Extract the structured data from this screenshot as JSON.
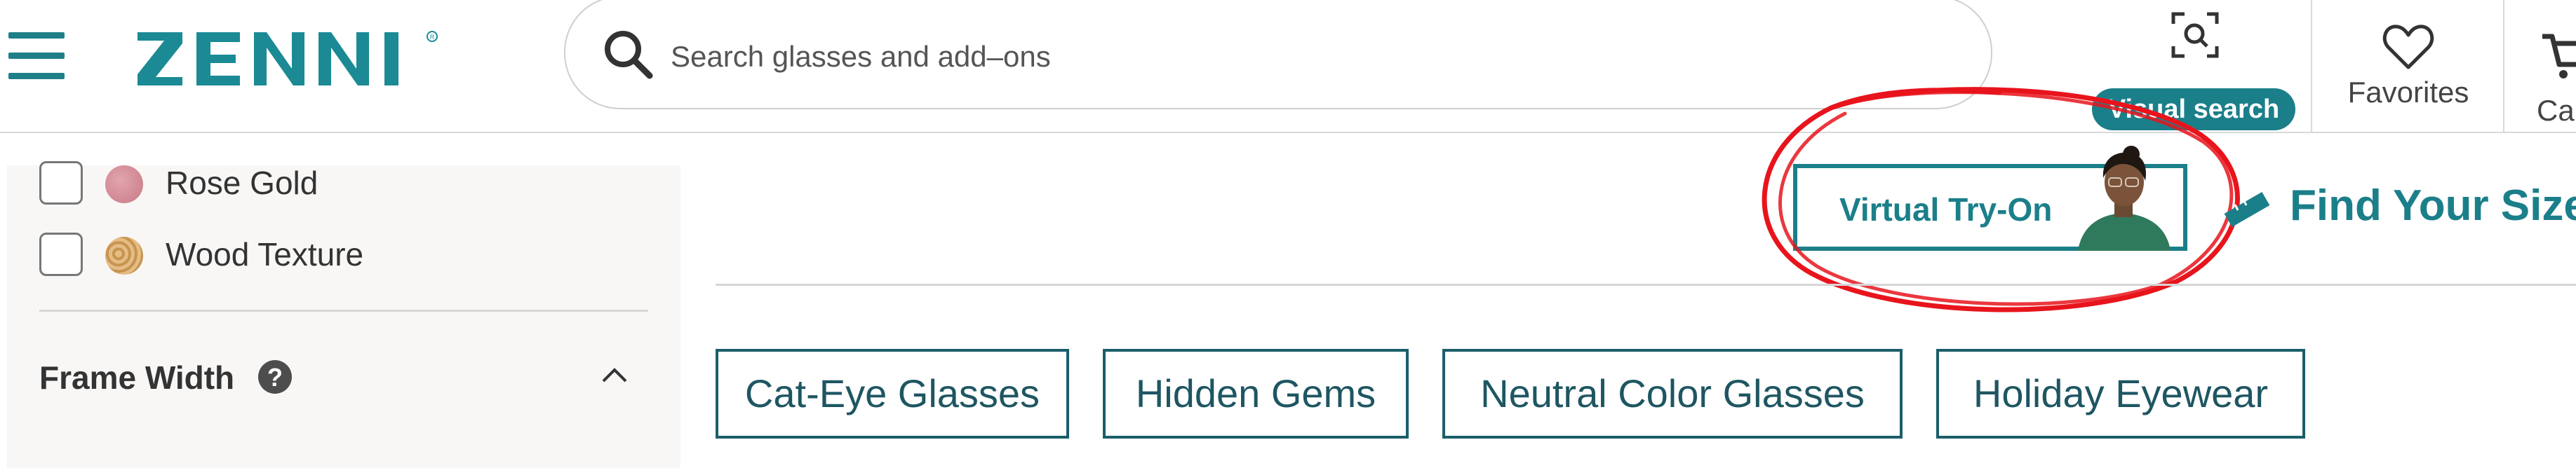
{
  "header": {
    "logo_text": "ZENNI",
    "search": {
      "placeholder": "Search glasses and add–ons"
    },
    "visual_search_label": "Visual search",
    "favorites_label": "Favorites",
    "cart_label": "Cart"
  },
  "sidebar": {
    "color_options": [
      {
        "label": "Rose Gold"
      },
      {
        "label": "Wood Texture"
      }
    ],
    "frame_width": {
      "label": "Frame Width"
    }
  },
  "main": {
    "virtual_try_on_label": "Virtual Try-On",
    "find_your_size_label": "Find Your Size",
    "tags": [
      {
        "label": "Cat-Eye Glasses"
      },
      {
        "label": "Hidden Gems"
      },
      {
        "label": "Neutral Color Glasses"
      },
      {
        "label": "Holiday Eyewear"
      }
    ]
  },
  "colors": {
    "brand_teal": "#1b7f8a",
    "annotation_red": "#e8141c",
    "tag_border": "#1b5e6a"
  },
  "icons": [
    "menu-icon",
    "search-icon",
    "visual-search-icon",
    "heart-icon",
    "cart-icon",
    "help-icon",
    "chevron-up-icon",
    "ruler-icon"
  ]
}
